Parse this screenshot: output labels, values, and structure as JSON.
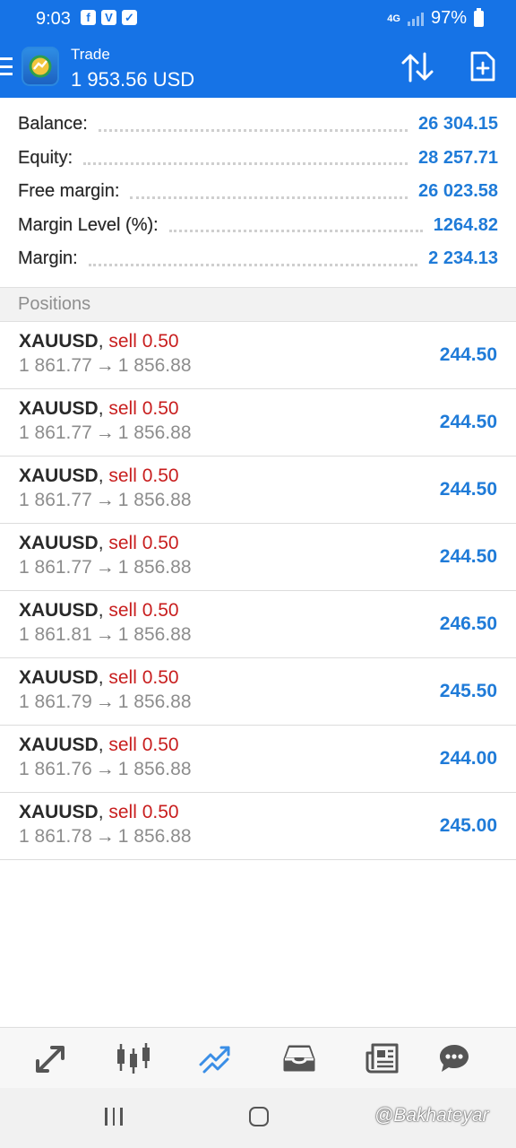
{
  "status_bar": {
    "time": "9:03",
    "network": "4G",
    "battery": "97%"
  },
  "app_bar": {
    "title": "Trade",
    "subtitle": "1 953.56 USD"
  },
  "summary": [
    {
      "label": "Balance:",
      "value": "26 304.15"
    },
    {
      "label": "Equity:",
      "value": "28 257.71"
    },
    {
      "label": "Free margin:",
      "value": "26 023.58"
    },
    {
      "label": "Margin Level (%):",
      "value": "1264.82"
    },
    {
      "label": "Margin:",
      "value": "2 234.13"
    }
  ],
  "positions": {
    "title": "Positions",
    "items": [
      {
        "symbol": "XAUUSD",
        "type": "sell 0.50",
        "open": "1 861.77",
        "current": "1 856.88",
        "profit": "244.50"
      },
      {
        "symbol": "XAUUSD",
        "type": "sell 0.50",
        "open": "1 861.77",
        "current": "1 856.88",
        "profit": "244.50"
      },
      {
        "symbol": "XAUUSD",
        "type": "sell 0.50",
        "open": "1 861.77",
        "current": "1 856.88",
        "profit": "244.50"
      },
      {
        "symbol": "XAUUSD",
        "type": "sell 0.50",
        "open": "1 861.77",
        "current": "1 856.88",
        "profit": "244.50"
      },
      {
        "symbol": "XAUUSD",
        "type": "sell 0.50",
        "open": "1 861.81",
        "current": "1 856.88",
        "profit": "246.50"
      },
      {
        "symbol": "XAUUSD",
        "type": "sell 0.50",
        "open": "1 861.79",
        "current": "1 856.88",
        "profit": "245.50"
      },
      {
        "symbol": "XAUUSD",
        "type": "sell 0.50",
        "open": "1 861.76",
        "current": "1 856.88",
        "profit": "244.00"
      },
      {
        "symbol": "XAUUSD",
        "type": "sell 0.50",
        "open": "1 861.78",
        "current": "1 856.88",
        "profit": "245.00"
      }
    ]
  },
  "tabs": [
    {
      "name": "quotes",
      "icon": "quotes-arrows-icon",
      "active": false
    },
    {
      "name": "chart",
      "icon": "candlestick-chart-icon",
      "active": false
    },
    {
      "name": "trade",
      "icon": "trade-trend-icon",
      "active": true
    },
    {
      "name": "history",
      "icon": "inbox-tray-icon",
      "active": false
    },
    {
      "name": "news",
      "icon": "newspaper-icon",
      "active": false
    },
    {
      "name": "messages",
      "icon": "chat-bubble-icon",
      "active": false
    }
  ],
  "watermark": "@Bakhateyar",
  "colors": {
    "brand": "#1673e6",
    "value_blue": "#1f7bd8",
    "sell_red": "#c81e1e",
    "active_tab": "#3a8ee6",
    "inactive_tab": "#555555"
  }
}
